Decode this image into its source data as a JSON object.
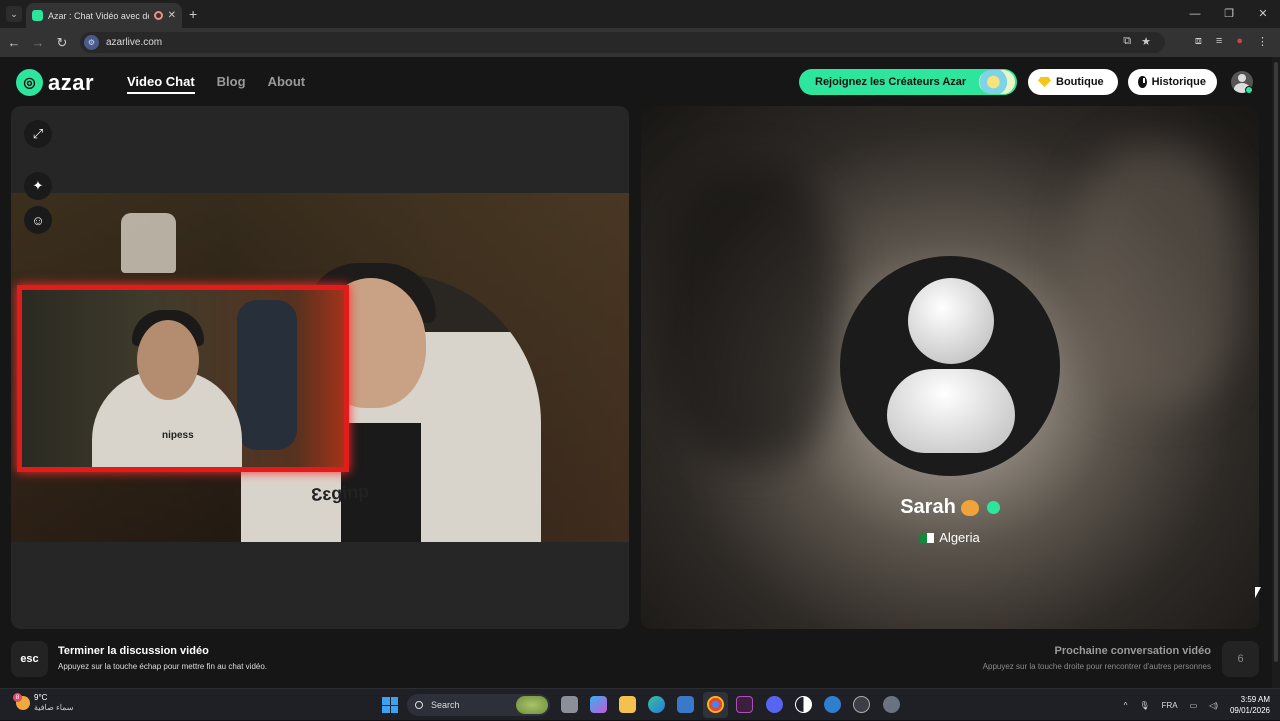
{
  "browser": {
    "tab_title": "Azar : Chat Vidéo avec de n",
    "url": "azarlive.com",
    "new_tab": "+",
    "tab_close": "✕",
    "window_controls": [
      "—",
      "❐",
      "✕"
    ]
  },
  "header": {
    "logo_text": "azar",
    "nav": [
      "Video Chat",
      "Blog",
      "About"
    ],
    "creators_button": "Rejoignez les Créateurs Azar",
    "boutique_button": "Boutique",
    "historique_button": "Historique"
  },
  "partner": {
    "name": "Sarah",
    "country": "Algeria"
  },
  "hints": {
    "end_key": "esc",
    "end_title": "Terminer la discussion vidéo",
    "end_sub": "Appuyez sur la touche échap pour mettre fin au chat vidéo.",
    "next_title": "Prochaine conversation vidéo",
    "next_sub": "Appuyez sur la touche droite pour rencontrer d'autres personnes",
    "next_key": "6"
  },
  "cam_overlay_text": "nipess",
  "cam_shirt_text": "Ɛɛginp",
  "taskbar": {
    "weather_badge": "8",
    "temperature": "9°C",
    "weather_desc": "سماء صافية",
    "search_placeholder": "Search",
    "language": "FRA",
    "time": "3:59 AM",
    "date": "09/01/2026"
  },
  "colors": {
    "accent": "#2ee59d",
    "pip_border": "#e21b1b",
    "panel_bg": "#262626"
  },
  "icons": [
    "expand-icon",
    "sparkle-icon",
    "face-filter-icon",
    "gem-icon",
    "clock-icon",
    "user-avatar-icon"
  ]
}
